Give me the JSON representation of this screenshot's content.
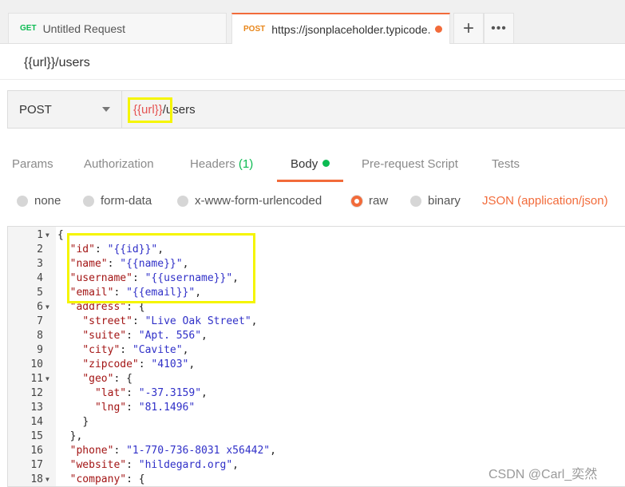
{
  "tabs": [
    {
      "method": "GET",
      "label": "Untitled Request"
    },
    {
      "method": "POST",
      "label": "https://jsonplaceholder.typicode.com/users"
    }
  ],
  "tab_actions": {
    "add": "+",
    "more": "•••"
  },
  "request": {
    "name": "{{url}}/users",
    "method": "POST",
    "url_var": "{{url}}",
    "url_rest": "/users"
  },
  "subtabs": {
    "params": "Params",
    "authorization": "Authorization",
    "headers": "Headers",
    "headers_count": "(1)",
    "body": "Body",
    "prerequest": "Pre-request Script",
    "tests": "Tests"
  },
  "body_types": {
    "none": "none",
    "form_data": "form-data",
    "urlencoded": "x-www-form-urlencoded",
    "raw": "raw",
    "binary": "binary",
    "content_type": "JSON (application/json)",
    "selected": "raw"
  },
  "editor_lines": [
    {
      "n": "1",
      "fold": true,
      "indent": "",
      "parts": [
        [
          "p",
          "{"
        ]
      ]
    },
    {
      "n": "2",
      "fold": false,
      "indent": "  ",
      "parts": [
        [
          "k",
          "\"id\""
        ],
        [
          "p",
          ": "
        ],
        [
          "s",
          "\"{{id}}\""
        ],
        [
          "p",
          ","
        ]
      ]
    },
    {
      "n": "3",
      "fold": false,
      "indent": "  ",
      "parts": [
        [
          "k",
          "\"name\""
        ],
        [
          "p",
          ": "
        ],
        [
          "s",
          "\"{{name}}\""
        ],
        [
          "p",
          ","
        ]
      ]
    },
    {
      "n": "4",
      "fold": false,
      "indent": "  ",
      "parts": [
        [
          "k",
          "\"username\""
        ],
        [
          "p",
          ": "
        ],
        [
          "s",
          "\"{{username}}\""
        ],
        [
          "p",
          ","
        ]
      ]
    },
    {
      "n": "5",
      "fold": false,
      "indent": "  ",
      "parts": [
        [
          "k",
          "\"email\""
        ],
        [
          "p",
          ": "
        ],
        [
          "s",
          "\"{{email}}\""
        ],
        [
          "p",
          ","
        ]
      ]
    },
    {
      "n": "6",
      "fold": true,
      "indent": "  ",
      "parts": [
        [
          "k",
          "\"address\""
        ],
        [
          "p",
          ": {"
        ]
      ]
    },
    {
      "n": "7",
      "fold": false,
      "indent": "    ",
      "parts": [
        [
          "k",
          "\"street\""
        ],
        [
          "p",
          ": "
        ],
        [
          "s",
          "\"Live Oak Street\""
        ],
        [
          "p",
          ","
        ]
      ]
    },
    {
      "n": "8",
      "fold": false,
      "indent": "    ",
      "parts": [
        [
          "k",
          "\"suite\""
        ],
        [
          "p",
          ": "
        ],
        [
          "s",
          "\"Apt. 556\""
        ],
        [
          "p",
          ","
        ]
      ]
    },
    {
      "n": "9",
      "fold": false,
      "indent": "    ",
      "parts": [
        [
          "k",
          "\"city\""
        ],
        [
          "p",
          ": "
        ],
        [
          "s",
          "\"Cavite\""
        ],
        [
          "p",
          ","
        ]
      ]
    },
    {
      "n": "10",
      "fold": false,
      "indent": "    ",
      "parts": [
        [
          "k",
          "\"zipcode\""
        ],
        [
          "p",
          ": "
        ],
        [
          "s",
          "\"4103\""
        ],
        [
          "p",
          ","
        ]
      ]
    },
    {
      "n": "11",
      "fold": true,
      "indent": "    ",
      "parts": [
        [
          "k",
          "\"geo\""
        ],
        [
          "p",
          ": {"
        ]
      ]
    },
    {
      "n": "12",
      "fold": false,
      "indent": "      ",
      "parts": [
        [
          "k",
          "\"lat\""
        ],
        [
          "p",
          ": "
        ],
        [
          "s",
          "\"-37.3159\""
        ],
        [
          "p",
          ","
        ]
      ]
    },
    {
      "n": "13",
      "fold": false,
      "indent": "      ",
      "parts": [
        [
          "k",
          "\"lng\""
        ],
        [
          "p",
          ": "
        ],
        [
          "s",
          "\"81.1496\""
        ]
      ]
    },
    {
      "n": "14",
      "fold": false,
      "indent": "    ",
      "parts": [
        [
          "p",
          "}"
        ]
      ]
    },
    {
      "n": "15",
      "fold": false,
      "indent": "  ",
      "parts": [
        [
          "p",
          "},"
        ]
      ]
    },
    {
      "n": "16",
      "fold": false,
      "indent": "  ",
      "parts": [
        [
          "k",
          "\"phone\""
        ],
        [
          "p",
          ": "
        ],
        [
          "s",
          "\"1-770-736-8031 x56442\""
        ],
        [
          "p",
          ","
        ]
      ]
    },
    {
      "n": "17",
      "fold": false,
      "indent": "  ",
      "parts": [
        [
          "k",
          "\"website\""
        ],
        [
          "p",
          ": "
        ],
        [
          "s",
          "\"hildegard.org\""
        ],
        [
          "p",
          ","
        ]
      ]
    },
    {
      "n": "18",
      "fold": true,
      "indent": "  ",
      "parts": [
        [
          "k",
          "\"company\""
        ],
        [
          "p",
          ": {"
        ]
      ]
    }
  ],
  "watermark": "CSDN @Carl_奕然",
  "colors": {
    "accent": "#f26b3a",
    "get": "#0cbb52",
    "post": "#e8861a",
    "highlight": "#f5f500",
    "variable": "#e55353"
  }
}
